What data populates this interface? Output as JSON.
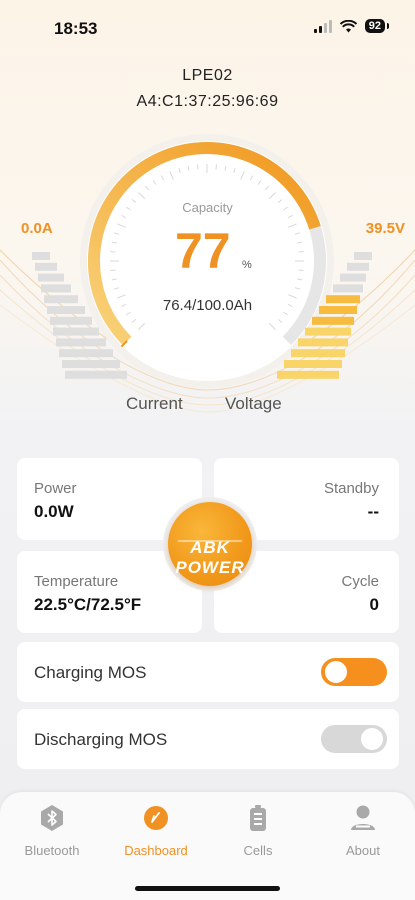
{
  "status_bar": {
    "time": "18:53",
    "battery": "92"
  },
  "device": {
    "name": "LPE02",
    "mac": "A4:C1:37:25:96:69"
  },
  "gauge": {
    "label": "Capacity",
    "percent": "77",
    "unit": "%",
    "amp_hours": "76.4/100.0Ah",
    "fill_fraction": 0.77
  },
  "current": {
    "value": "0.0A",
    "label": "Current",
    "level_fraction": 0.0
  },
  "voltage": {
    "value": "39.5V",
    "label": "Voltage",
    "level_fraction": 0.7
  },
  "cards": {
    "power": {
      "label": "Power",
      "value": "0.0W"
    },
    "standby": {
      "label": "Standby",
      "value": "--"
    },
    "temperature": {
      "label": "Temperature",
      "value": "22.5°C/72.5°F"
    },
    "cycle": {
      "label": "Cycle",
      "value": "0"
    }
  },
  "logo_text": "ABK POWER",
  "switches": {
    "charging": {
      "label": "Charging MOS",
      "state": "on"
    },
    "discharging": {
      "label": "Discharging MOS",
      "state": "off"
    }
  },
  "tabs": [
    {
      "label": "Bluetooth",
      "icon": "bluetooth-icon",
      "active": false
    },
    {
      "label": "Dashboard",
      "icon": "dashboard-icon",
      "active": true
    },
    {
      "label": "Cells",
      "icon": "battery-cells-icon",
      "active": false
    },
    {
      "label": "About",
      "icon": "user-icon",
      "active": false
    }
  ],
  "colors": {
    "accent": "#f09123",
    "inactive": "#999999"
  }
}
